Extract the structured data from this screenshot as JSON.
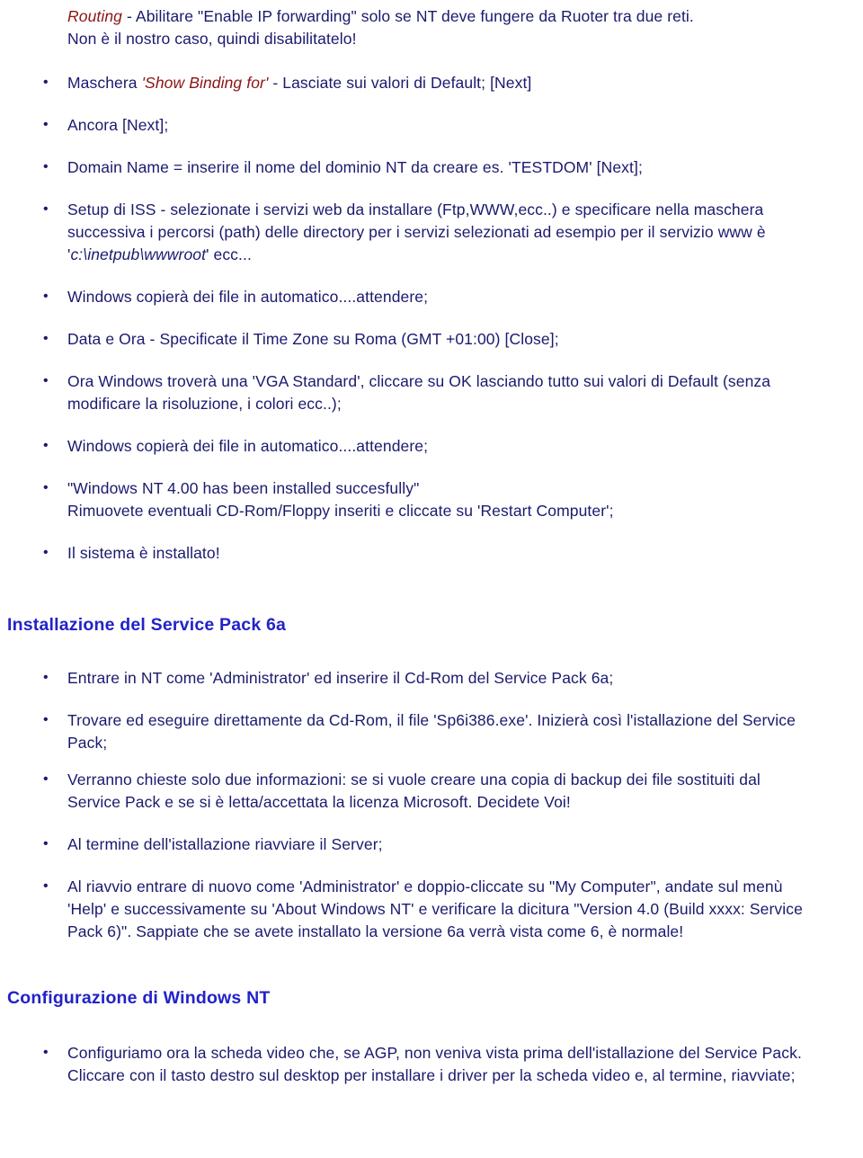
{
  "colors": {
    "body_text": "#1a1a6e",
    "heading": "#2222c8",
    "emphasis_red": "#8c1414",
    "background": "#ffffff"
  },
  "intro": {
    "keyword": "Routing",
    "line1_rest": " - Abilitare \"Enable IP forwarding\" solo se NT deve fungere da Ruoter tra due reti.",
    "line2": "Non è il nostro caso, quindi disabilitatelo!"
  },
  "list_one": [
    {
      "prefix": "Maschera ",
      "emphasis": "'Show Binding for'",
      "suffix": " - Lasciate sui valori di Default; [Next]"
    },
    {
      "text": "Ancora [Next];"
    },
    {
      "text": "Domain Name = inserire il nome del dominio NT da creare es. 'TESTDOM' [Next];"
    },
    {
      "prefix": "Setup di ISS - selezionate i servizi web da installare (Ftp,WWW,ecc..) e specificare nella maschera successiva i percorsi (path) delle directory per i servizi selezionati ad esempio per il servizio www è '",
      "italic": "c:\\inetpub\\wwwroot",
      "suffix": "' ecc..."
    },
    {
      "text": "Windows copierà dei file in automatico....attendere;"
    },
    {
      "text": "Data e Ora - Specificate il Time Zone su Roma (GMT +01:00) [Close];"
    },
    {
      "text": "Ora Windows troverà una 'VGA Standard', cliccare su OK lasciando tutto sui valori di Default (senza modificare la risoluzione, i colori ecc..);"
    },
    {
      "text": "Windows copierà dei file in automatico....attendere;"
    },
    {
      "text": "\"Windows NT 4.00 has been installed succesfully\"\nRimuovete eventuali CD-Rom/Floppy inseriti e cliccate su 'Restart Computer';"
    },
    {
      "text": "Il sistema è installato!"
    }
  ],
  "section_sp": {
    "heading": "Installazione del Service Pack 6a",
    "items": [
      {
        "text": "Entrare in NT come 'Administrator' ed inserire il Cd-Rom del Service Pack 6a;"
      },
      {
        "text": "Trovare ed eseguire direttamente da Cd-Rom, il file 'Sp6i386.exe'. Inizierà così l'istallazione del Service Pack;"
      },
      {
        "text": "Verranno chieste solo due informazioni: se si vuole creare una copia di backup dei file sostituiti dal Service Pack e se si è letta/accettata la licenza Microsoft. Decidete Voi!"
      },
      {
        "text": "Al termine dell'istallazione riavviare il Server;"
      },
      {
        "text": "Al riavvio entrare di nuovo come 'Administrator' e doppio-cliccate su \"My Computer\", andate sul menù 'Help' e successivamente su 'About Windows NT' e verificare la dicitura \"Version 4.0 (Build xxxx: Service Pack 6)\". Sappiate che se avete installato la versione 6a verrà vista come 6, è normale!"
      }
    ]
  },
  "section_config": {
    "heading": "Configurazione di Windows NT",
    "items": [
      {
        "text": "Configuriamo ora la scheda video che, se AGP, non veniva vista prima dell'istallazione del Service Pack.\nCliccare con il tasto destro sul desktop per installare i driver per la scheda video e, al termine, riavviate;"
      }
    ]
  }
}
